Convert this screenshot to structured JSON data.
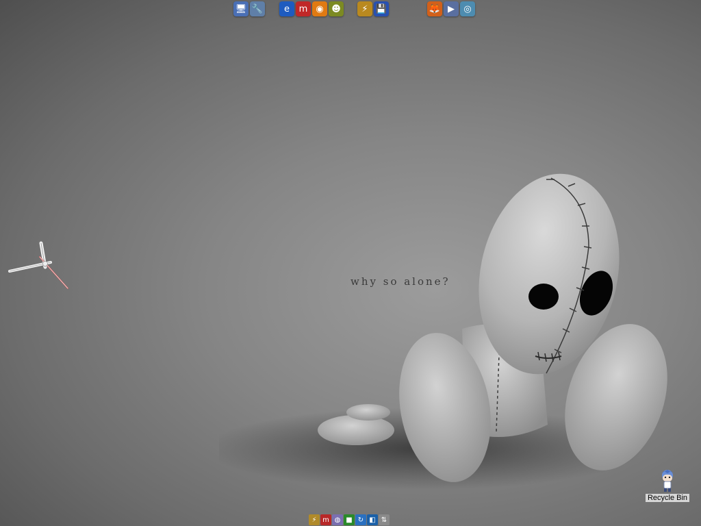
{
  "wallpaper": {
    "tagline": "why so alone?"
  },
  "top_dock": {
    "groups": [
      {
        "icons": [
          {
            "name": "my-computer-icon",
            "glyph": "🖥",
            "color": "#4a6fb5"
          },
          {
            "name": "network-icon",
            "glyph": "🔧",
            "color": "#5f7fa8"
          }
        ]
      },
      {
        "icons": [
          {
            "name": "internet-explorer-icon",
            "glyph": "e",
            "color": "#1e5bbf"
          },
          {
            "name": "messenger-icon",
            "glyph": "m",
            "color": "#c02828"
          },
          {
            "name": "media-player-icon",
            "glyph": "◉",
            "color": "#e07a12"
          },
          {
            "name": "chat-icon",
            "glyph": "☻",
            "color": "#7c8a22"
          }
        ]
      },
      {
        "icons": [
          {
            "name": "tools-icon",
            "glyph": "⚡",
            "color": "#b9891f"
          },
          {
            "name": "save-disk-icon",
            "glyph": "💾",
            "color": "#2850b0"
          }
        ]
      },
      {
        "icons": [
          {
            "name": "firefox-icon",
            "glyph": "🦊",
            "color": "#d2601a"
          },
          {
            "name": "video-icon",
            "glyph": "▶",
            "color": "#5a6fa0"
          },
          {
            "name": "photo-icon",
            "glyph": "◎",
            "color": "#4d8cb0"
          }
        ]
      }
    ]
  },
  "bottom_dock": {
    "icons": [
      {
        "name": "winamp-icon",
        "glyph": "⚡",
        "color": "#b08a2a"
      },
      {
        "name": "msn-icon",
        "glyph": "m",
        "color": "#b82828"
      },
      {
        "name": "globe-icon",
        "glyph": "◍",
        "color": "#7a6fb0"
      },
      {
        "name": "windows-icon",
        "glyph": "■",
        "color": "#2a8a2a"
      },
      {
        "name": "refresh-icon",
        "glyph": "↻",
        "color": "#2a70c0"
      },
      {
        "name": "app-icon",
        "glyph": "◧",
        "color": "#1a60a8"
      },
      {
        "name": "network-drive-icon",
        "glyph": "⇅",
        "color": "#8a8a8a"
      }
    ]
  },
  "desktop_icons": {
    "recycle_bin": {
      "label": "Recycle Bin"
    }
  }
}
